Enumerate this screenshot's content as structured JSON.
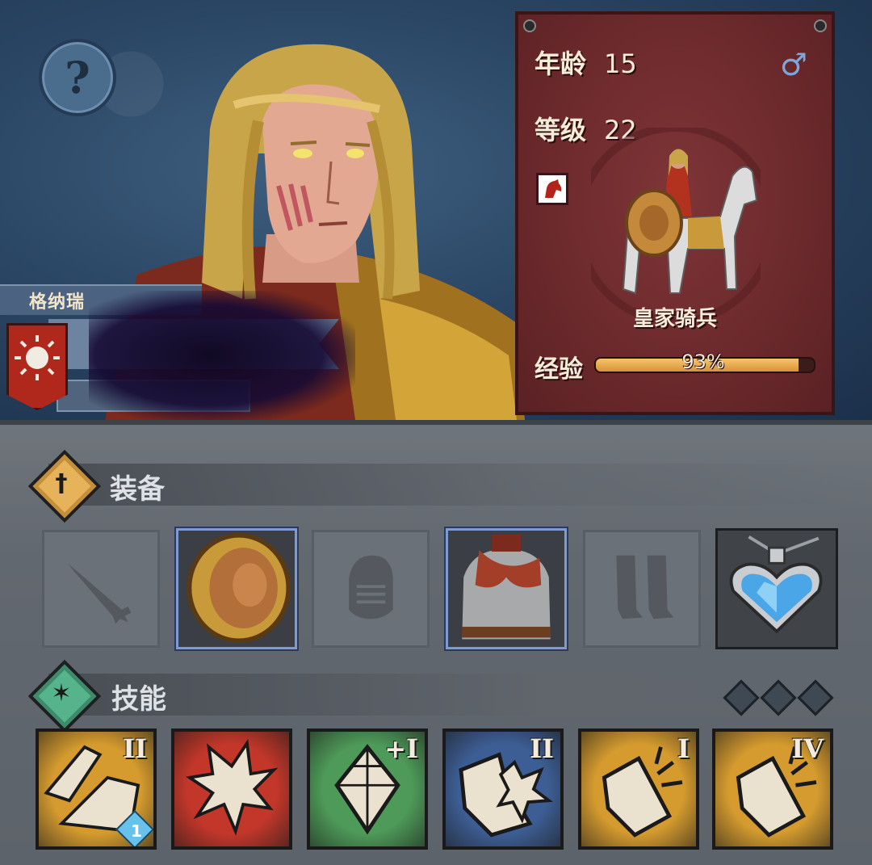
{
  "faction": {
    "name": "格纳瑞",
    "color": "#b0271c"
  },
  "stats": {
    "age_label": "年龄",
    "age_value": "15",
    "level_label": "等级",
    "level_value": "22",
    "gender_icon": "male-icon",
    "unit_type": "皇家骑兵",
    "xp_label": "经验",
    "xp_percent_text": "93%",
    "xp_fraction": 0.93
  },
  "equipment": {
    "title": "装备",
    "slots": [
      {
        "type": "weapon",
        "icon": "sword-icon",
        "state": "empty"
      },
      {
        "type": "shield",
        "icon": "round-shield-icon",
        "state": "equipped"
      },
      {
        "type": "helmet",
        "icon": "helmet-icon",
        "state": "empty"
      },
      {
        "type": "armor",
        "icon": "chainmail-armor-icon",
        "state": "equipped"
      },
      {
        "type": "boots",
        "icon": "greaves-icon",
        "state": "empty"
      },
      {
        "type": "trinket",
        "icon": "heart-amulet-icon",
        "state": "equipped"
      }
    ]
  },
  "skills": {
    "title": "技能",
    "points": 3,
    "items": [
      {
        "icon": "cavalry-charge-icon",
        "color": "#d59b2e",
        "tier": "II",
        "gem_count": "1"
      },
      {
        "icon": "crushing-blow-icon",
        "color": "#c3372a",
        "tier": ""
      },
      {
        "icon": "crystal-icon",
        "color": "#4e9a58",
        "tier": "+I"
      },
      {
        "icon": "shield-bash-icon",
        "color": "#3d5e95",
        "tier": "II"
      },
      {
        "icon": "shield-block-icon",
        "color": "#d59b2e",
        "tier": "I"
      },
      {
        "icon": "shield-block-icon",
        "color": "#d59b2e",
        "tier": "IV"
      }
    ]
  }
}
